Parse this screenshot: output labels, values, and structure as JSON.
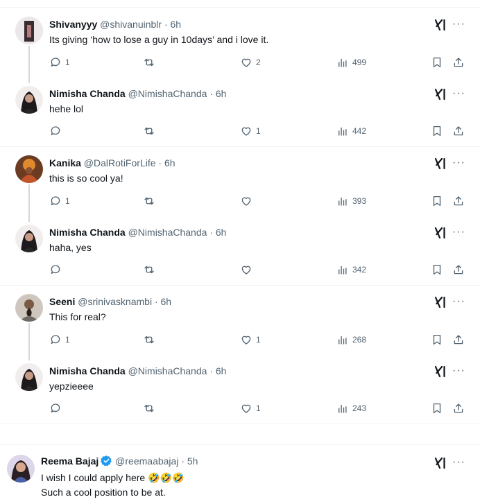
{
  "colors": {
    "text": "#0f1419",
    "muted": "#536471",
    "divider": "#eff3f4",
    "verified": "#1d9bf0"
  },
  "tweets": [
    {
      "name": "Shivanyyy",
      "handle": "@shivanuinblr",
      "time": "· 6h",
      "text": "Its giving ‘how to lose a guy in 10days’ and i love it.",
      "replies": "1",
      "likes": "2",
      "views": "499"
    },
    {
      "name": "Nimisha Chanda",
      "handle": "@NimishaChanda",
      "time": "· 6h",
      "text": "hehe lol",
      "replies": "",
      "likes": "1",
      "views": "442"
    },
    {
      "name": "Kanika",
      "handle": "@DalRotiForLife",
      "time": "· 6h",
      "text": "this is so cool ya!",
      "replies": "1",
      "likes": "",
      "views": "393"
    },
    {
      "name": "Nimisha Chanda",
      "handle": "@NimishaChanda",
      "time": "· 6h",
      "text": "haha, yes",
      "replies": "",
      "likes": "",
      "views": "342"
    },
    {
      "name": "Seeni",
      "handle": "@srinivasknambi",
      "time": "· 6h",
      "text": "This for real?",
      "replies": "1",
      "likes": "1",
      "views": "268"
    },
    {
      "name": "Nimisha Chanda",
      "handle": "@NimishaChanda",
      "time": "· 6h",
      "text": "yepzieeee",
      "replies": "",
      "likes": "1",
      "views": "243"
    }
  ],
  "last_tweet": {
    "name": "Reema Bajaj",
    "handle": "@reemaabajaj",
    "time": "· 5h",
    "line1": "I wish I could apply here",
    "emoji": "🤣🤣🤣",
    "line2": "Such a cool position to be at."
  },
  "icons": {
    "grok": "grok-icon",
    "more": "more-icon",
    "reply": "reply-icon",
    "retweet": "retweet-icon",
    "like": "like-icon",
    "views": "views-icon",
    "bookmark": "bookmark-icon",
    "share": "share-icon"
  },
  "more_glyph": "···"
}
